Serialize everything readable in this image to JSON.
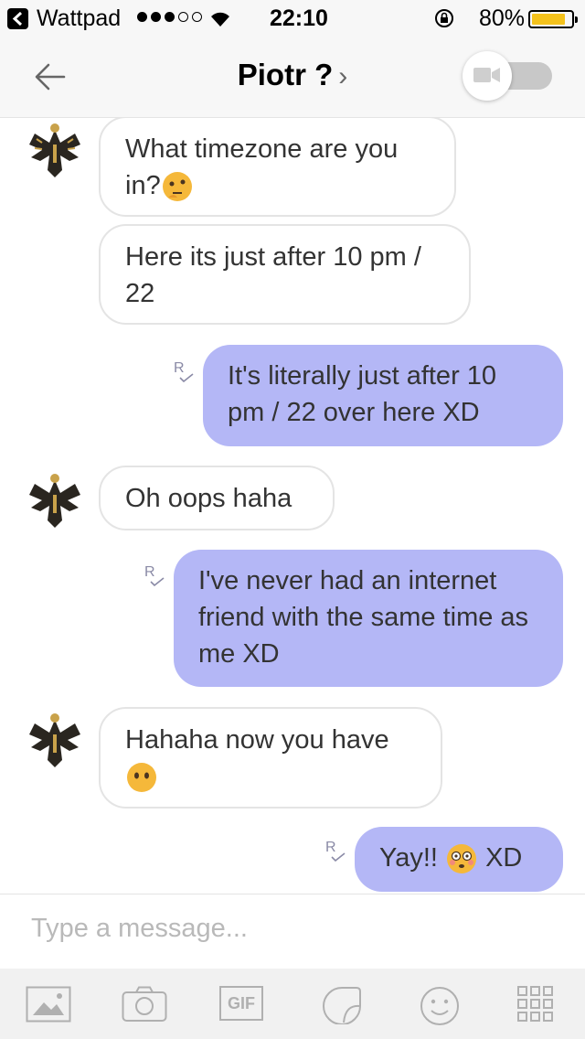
{
  "status_bar": {
    "app_name": "Wattpad",
    "time": "22:10",
    "battery": "80%",
    "battery_level": 0.8,
    "signal_bars_filled": 3,
    "signal_bars_total": 5
  },
  "header": {
    "title": "Piotr ?",
    "chevron": "›",
    "video_toggle_on": false
  },
  "messages": [
    {
      "side": "in",
      "text": "What timezone are you in?",
      "emoji": "thinking-face"
    },
    {
      "side": "in",
      "text": "Here its just after 10 pm / 22"
    },
    {
      "side": "out",
      "text": "It's literally just after 10 pm / 22 over here XD",
      "read": "R"
    },
    {
      "side": "in",
      "text": "Oh oops haha"
    },
    {
      "side": "out",
      "text": "I've never had an internet friend with the same time as me XD",
      "read": "R"
    },
    {
      "side": "in",
      "text": "Hahaha now you have",
      "emoji": "face-without-mouth"
    },
    {
      "side": "out",
      "text_before": "Yay!!",
      "text_after": "XD",
      "emoji": "flushed-face",
      "read": "R"
    }
  ],
  "compose": {
    "placeholder": "Type a message..."
  },
  "toolbar": {
    "gif_label": "GIF",
    "tools": [
      "image-icon",
      "camera-icon",
      "gif-icon",
      "sticker-icon",
      "smiley-icon",
      "grid-icon"
    ]
  },
  "colors": {
    "outgoing_bubble": "#b4b7f6",
    "incoming_border": "#e4e4e4",
    "battery_fill": "#f4c21c"
  }
}
